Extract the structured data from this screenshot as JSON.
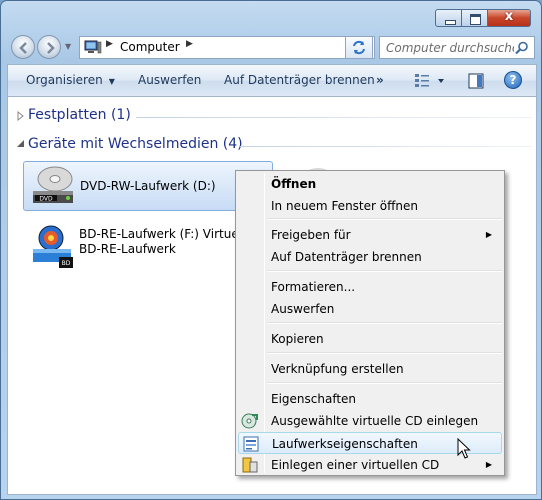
{
  "window": {
    "caption_close": "x"
  },
  "address": {
    "crumb": "Computer",
    "sep1": "▶",
    "sep2": "▶",
    "dropdown": "▾"
  },
  "search": {
    "placeholder": "Computer durchsuchen"
  },
  "commandbar": {
    "organize": "Organisieren",
    "eject": "Auswerfen",
    "burn": "Auf Datenträger brennen",
    "more": "»",
    "dropdown_arrow": "▼"
  },
  "groups": [
    {
      "title": "Festplatten (1)",
      "expanded": false
    },
    {
      "title": "Geräte mit Wechselmedien (4)",
      "expanded": true
    }
  ],
  "drives": [
    {
      "label": "DVD-RW-Laufwerk (D:)",
      "icon_text": "DVD",
      "selected": true
    },
    {
      "line1": "BD-RE-Laufwerk (F:) Virtuelles",
      "line2": "BD-RE-Laufwerk",
      "icon_text": "BD"
    }
  ],
  "context_menu": {
    "items": [
      {
        "label": "Öffnen",
        "bold": true
      },
      {
        "label": "In neuem Fenster öffnen"
      },
      {
        "label": "Freigeben für",
        "submenu": "▶"
      },
      {
        "label": "Auf Datenträger brennen"
      },
      {
        "label": "Formatieren..."
      },
      {
        "label": "Auswerfen"
      },
      {
        "label": "Kopieren"
      },
      {
        "label": "Verknüpfung erstellen"
      },
      {
        "label": "Eigenschaften"
      },
      {
        "label": "Ausgewählte virtuelle CD einlegen",
        "icon": "cd-insert-icon"
      },
      {
        "label": "Laufwerkseigenschaften",
        "icon": "drive-properties-icon",
        "hovered": true
      },
      {
        "label": "Einlegen einer virtuellen CD",
        "icon": "virtual-cd-icon",
        "submenu": "▶"
      }
    ]
  },
  "colors": {
    "group_title": "#1e3287",
    "command_text": "#1e395b",
    "selection_border": "#84acdd"
  }
}
